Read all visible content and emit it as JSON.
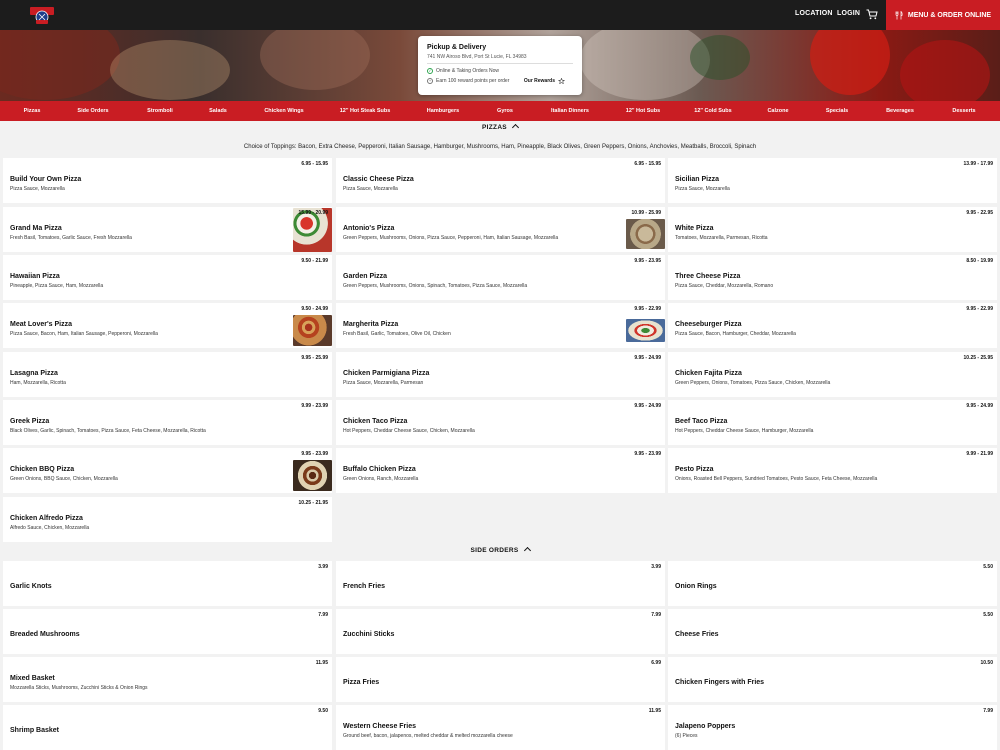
{
  "header": {
    "logo_text": "ANTONIO'S PIZZA",
    "nav": [
      "LOCATION",
      "LOGIN"
    ],
    "order_button": "MENU & ORDER ONLINE"
  },
  "pickup": {
    "title": "Pickup & Delivery",
    "address": "741 NW Airoso Blvd, Port St Lucie, FL 34983",
    "status": "Online & Taking Orders Now",
    "reward": "Earn 100 reward points per order",
    "rewards_link": "Our Rewards"
  },
  "categories": [
    "Pizzas",
    "Side Orders",
    "Stromboli",
    "Salads",
    "Chicken Wings",
    "12\" Hot Steak Subs",
    "Hamburgers",
    "Gyros",
    "Italian Dinners",
    "12\" Hot Subs",
    "12\" Cold Subs",
    "Calzone",
    "Specials",
    "Beverages",
    "Desserts"
  ],
  "sections": {
    "pizzas": {
      "title": "PIZZAS",
      "toppings": "Choice of Toppings: Bacon, Extra Cheese, Pepperoni, Italian Sausage, Hamburger, Mushrooms, Ham, Pineapple, Black Olives, Green Peppers, Onions, Anchovies, Meatballs, Broccoli, Spinach",
      "items": [
        {
          "name": "Build Your Own Pizza",
          "price": "6.95 - 15.95",
          "desc": "Pizza Sauce, Mozzarella"
        },
        {
          "name": "Classic Cheese Pizza",
          "price": "6.95 - 15.95",
          "desc": "Pizza Sauce, Mozzarella"
        },
        {
          "name": "Sicilian Pizza",
          "price": "13.99 - 17.99",
          "desc": "Pizza Sauce, Mozzarella"
        },
        {
          "name": "Grand Ma Pizza",
          "price": "15.99 - 20.99",
          "desc": "Fresh Basil, Tomatoes, Garlic Sauce, Fresh Mozzarella"
        },
        {
          "name": "Antonio's Pizza",
          "price": "10.99 - 25.99",
          "desc": "Green Peppers, Mushrooms, Onions, Pizza Sauce, Pepperoni, Ham, Italian Sausage, Mozzarella"
        },
        {
          "name": "White Pizza",
          "price": "9.95 - 22.95",
          "desc": "Tomatoes, Mozzarella, Parmesan, Ricotta"
        },
        {
          "name": "Hawaiian Pizza",
          "price": "9.50 - 21.99",
          "desc": "Pineapple, Pizza Sauce, Ham, Mozzarella"
        },
        {
          "name": "Garden Pizza",
          "price": "9.95 - 23.95",
          "desc": "Green Peppers, Mushrooms, Onions, Spinach, Tomatoes, Pizza Sauce, Mozzarella"
        },
        {
          "name": "Three Cheese Pizza",
          "price": "8.50 - 19.99",
          "desc": "Pizza Sauce, Cheddar, Mozzarella, Romano"
        },
        {
          "name": "Meat Lover's Pizza",
          "price": "9.50 - 24.99",
          "desc": "Pizza Sauce, Bacon, Ham, Italian Sausage, Pepperoni, Mozzarella"
        },
        {
          "name": "Margherita Pizza",
          "price": "9.95 - 22.99",
          "desc": "Fresh Basil, Garlic, Tomatoes, Olive Oil, Chicken"
        },
        {
          "name": "Cheeseburger Pizza",
          "price": "9.95 - 22.99",
          "desc": "Pizza Sauce, Bacon, Hamburger, Cheddar, Mozzarella"
        },
        {
          "name": "Lasagna Pizza",
          "price": "9.95 - 25.99",
          "desc": "Ham, Mozzarella, Ricotta"
        },
        {
          "name": "Chicken Parmigiana Pizza",
          "price": "9.95 - 24.99",
          "desc": "Pizza Sauce, Mozzarella, Parmesan"
        },
        {
          "name": "Chicken Fajita Pizza",
          "price": "10.25 - 25.95",
          "desc": "Green Peppers, Onions, Tomatoes, Pizza Sauce, Chicken, Mozzarella"
        },
        {
          "name": "Greek Pizza",
          "price": "9.99 - 23.99",
          "desc": "Black Olives, Garlic, Spinach, Tomatoes, Pizza Sauce, Feta Cheese, Mozzarella, Ricotta"
        },
        {
          "name": "Chicken Taco Pizza",
          "price": "9.95 - 24.99",
          "desc": "Hot Peppers, Cheddar Cheese Sauce, Chicken, Mozzarella"
        },
        {
          "name": "Beef Taco Pizza",
          "price": "9.95 - 24.99",
          "desc": "Hot Peppers, Cheddar Cheese Sauce, Hamburger, Mozzarella"
        },
        {
          "name": "Chicken BBQ Pizza",
          "price": "9.95 - 23.99",
          "desc": "Green Onions, BBQ Sauce, Chicken, Mozzarella"
        },
        {
          "name": "Buffalo Chicken Pizza",
          "price": "9.95 - 23.99",
          "desc": "Green Onions, Ranch, Mozzarella"
        },
        {
          "name": "Pesto Pizza",
          "price": "9.99 - 21.99",
          "desc": "Onions, Roasted Bell Peppers, Sundried Tomatoes, Pesto Sauce, Feta Cheese, Mozzarella"
        },
        {
          "name": "Chicken Alfredo Pizza",
          "price": "10.25 - 21.95",
          "desc": "Alfredo Sauce, Chicken, Mozzarella"
        }
      ]
    },
    "side_orders": {
      "title": "SIDE ORDERS",
      "items": [
        {
          "name": "Garlic Knots",
          "price": "3.99",
          "desc": ""
        },
        {
          "name": "French Fries",
          "price": "3.99",
          "desc": ""
        },
        {
          "name": "Onion Rings",
          "price": "5.50",
          "desc": ""
        },
        {
          "name": "Breaded Mushrooms",
          "price": "7.99",
          "desc": ""
        },
        {
          "name": "Zucchini Sticks",
          "price": "7.99",
          "desc": ""
        },
        {
          "name": "Cheese Fries",
          "price": "5.50",
          "desc": ""
        },
        {
          "name": "Mixed Basket",
          "price": "11.95",
          "desc": "Mozzarella Sticks, Mushrooms, Zucchini Sticks & Onion Rings"
        },
        {
          "name": "Pizza Fries",
          "price": "6.99",
          "desc": ""
        },
        {
          "name": "Chicken Fingers with Fries",
          "price": "10.50",
          "desc": ""
        },
        {
          "name": "Shrimp Basket",
          "price": "9.50",
          "desc": ""
        },
        {
          "name": "Western Cheese Fries",
          "price": "11.95",
          "desc": "Ground beef, bacon, jalapenos, melted cheddar & melted mozzarella cheese"
        },
        {
          "name": "Jalapeno Poppers",
          "price": "7.99",
          "desc": "(6) Pieces"
        }
      ]
    }
  },
  "colors": {
    "brand_red": "#c91d23",
    "topbar": "#1c1c1c",
    "status_green": "#2ea44f"
  }
}
